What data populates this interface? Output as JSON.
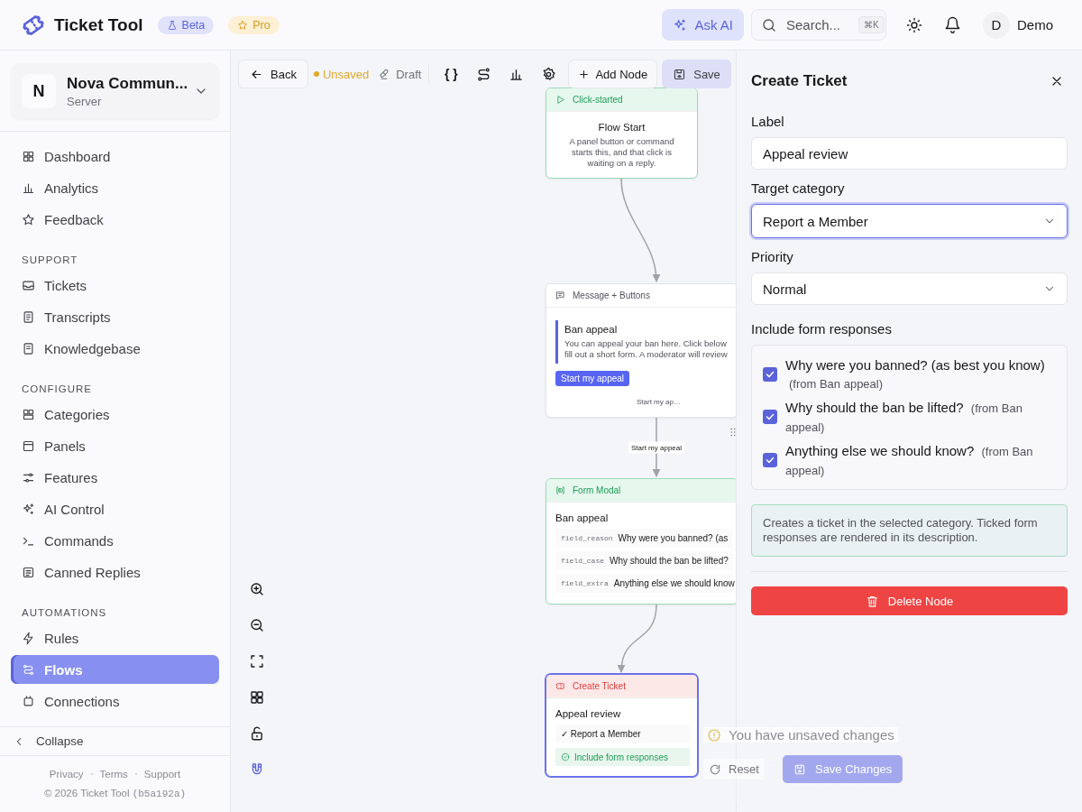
{
  "header": {
    "app_name": "Ticket Tool",
    "badges": [
      {
        "label": "Beta",
        "kind": "beta"
      },
      {
        "label": "Pro",
        "kind": "pro"
      }
    ],
    "ask_ai": "Ask AI",
    "search": {
      "placeholder": "Search...",
      "shortcut": "⌘K"
    },
    "user": {
      "initial": "D",
      "name": "Demo"
    }
  },
  "sidebar": {
    "server": {
      "initial": "N",
      "name": "Nova Commun...",
      "subtitle": "Server"
    },
    "sections": [
      {
        "items": [
          {
            "label": "Dashboard",
            "selected": false
          },
          {
            "label": "Analytics",
            "selected": false
          },
          {
            "label": "Feedback",
            "selected": false
          }
        ]
      },
      {
        "title": "SUPPORT",
        "items": [
          {
            "label": "Tickets",
            "selected": false
          },
          {
            "label": "Transcripts",
            "selected": false
          },
          {
            "label": "Knowledgebase",
            "selected": false
          }
        ]
      },
      {
        "title": "CONFIGURE",
        "items": [
          {
            "label": "Categories",
            "selected": false
          },
          {
            "label": "Panels",
            "selected": false
          },
          {
            "label": "Features",
            "selected": false
          },
          {
            "label": "AI Control",
            "selected": false
          },
          {
            "label": "Commands",
            "selected": false
          },
          {
            "label": "Canned Replies",
            "selected": false
          }
        ]
      },
      {
        "title": "AUTOMATIONS",
        "items": [
          {
            "label": "Rules",
            "selected": false
          },
          {
            "label": "Flows",
            "selected": true
          },
          {
            "label": "Connections",
            "selected": false
          }
        ]
      }
    ],
    "collapse": "Collapse",
    "footer_links": [
      "Privacy",
      "Terms",
      "Support"
    ],
    "copyright": "© 2026 Ticket Tool",
    "build": "(b5a192a)"
  },
  "toolbar": {
    "back": "Back",
    "status": "Unsaved",
    "mode": "Draft",
    "variables": "{ }",
    "add_node": "Add Node",
    "save": "Save"
  },
  "canvas": {
    "nodes": [
      {
        "kind": "trigger",
        "header": "Click-started",
        "title": "Flow Start",
        "description": "A panel button or command starts this, and that click is waiting on a reply.",
        "selected": false
      },
      {
        "kind": "message",
        "header": "Message + Buttons",
        "title": "Ban appeal",
        "description_lines": [
          "You can appeal your ban here. Click below",
          "fill out a short form. A moderator will review"
        ],
        "button": "Start my appeal",
        "handle_label": "Start my ap…",
        "edge_label": "Start my appeal",
        "selected": false
      },
      {
        "kind": "form",
        "header": "Form Modal",
        "title": "Ban appeal",
        "fields": [
          {
            "key": "field_reason",
            "label": "Why were you banned? (as"
          },
          {
            "key": "field_case",
            "label": "Why should the ban be lifted?"
          },
          {
            "key": "field_extra",
            "label": "Anything else we should know"
          }
        ],
        "selected": false
      },
      {
        "kind": "ticket",
        "header": "Create Ticket",
        "title": "Appeal review",
        "category": "✓ Report a Member",
        "option": "Include form responses",
        "selected": true
      }
    ],
    "controls": [
      {
        "kind": "zoom_in",
        "active": false
      },
      {
        "kind": "zoom_out",
        "active": false
      },
      {
        "kind": "fit",
        "active": false
      },
      {
        "kind": "grid",
        "active": false
      },
      {
        "kind": "lock",
        "active": false
      },
      {
        "kind": "snap",
        "active": true
      }
    ]
  },
  "panel": {
    "title": "Create Ticket",
    "fields": [
      {
        "kind": "text",
        "label": "Label",
        "value": "Appeal review",
        "focused": false
      },
      {
        "kind": "select",
        "label": "Target category",
        "value": "Report a Member",
        "focused": true
      },
      {
        "kind": "select",
        "label": "Priority",
        "value": "Normal",
        "focused": false
      }
    ],
    "responses_label": "Include form responses",
    "responses": [
      {
        "question": "Why were you banned? (as best you know)",
        "source": "(from Ban appeal)",
        "checked": true
      },
      {
        "question": "Why should the ban be lifted?",
        "source": "(from Ban appeal)",
        "checked": true
      },
      {
        "question": "Anything else we should know?",
        "source": "(from Ban appeal)",
        "checked": true
      }
    ],
    "info": "Creates a ticket in the selected category. Ticked form responses are rendered in its description.",
    "delete": "Delete Node"
  },
  "toast": {
    "message": "You have unsaved changes",
    "reset": "Reset",
    "save": "Save Changes"
  }
}
